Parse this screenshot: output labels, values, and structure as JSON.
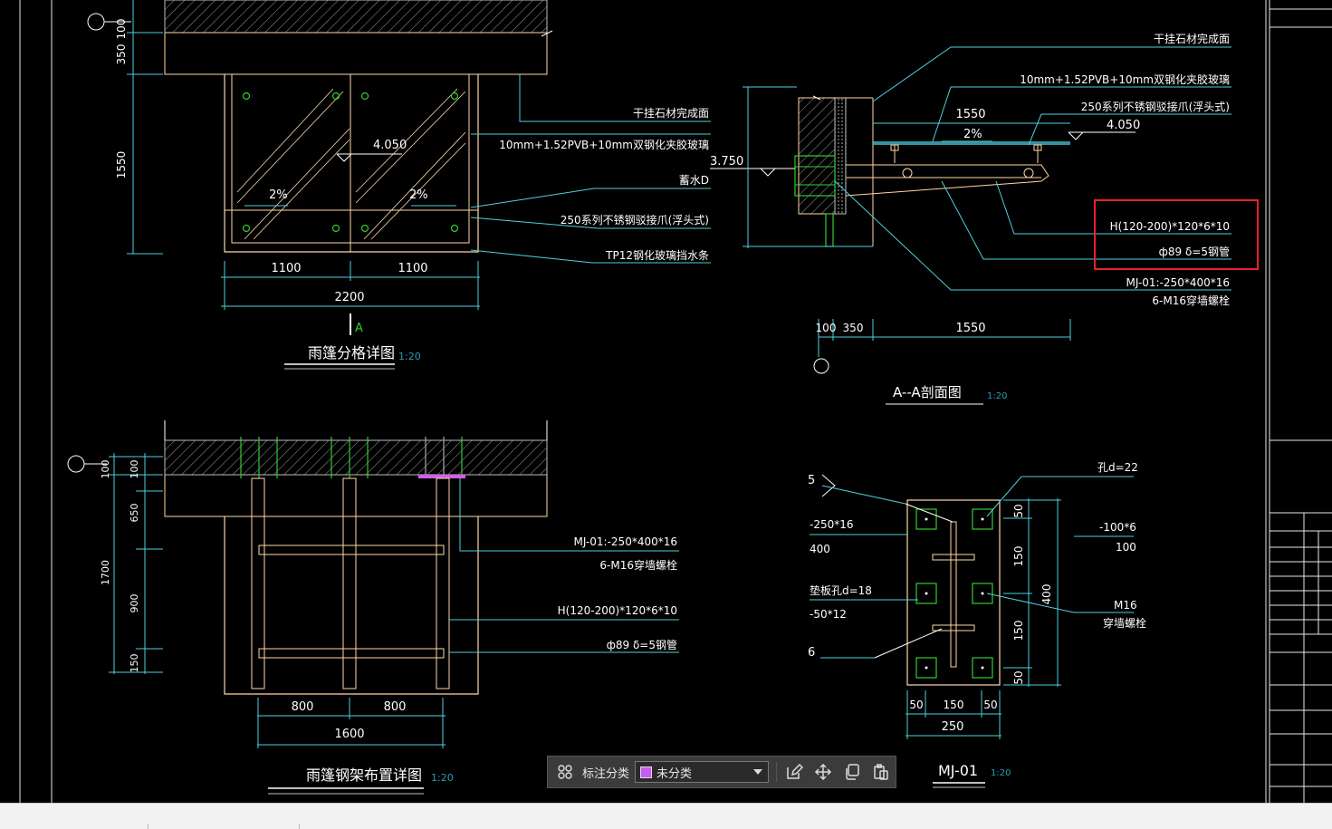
{
  "colors": {
    "background": "#000000",
    "white_text": "#ffffff",
    "hatch": "#b7b7b7",
    "outline": "#ffd7a6",
    "dim": "#4dd0e1",
    "leader": "#4dd0e1",
    "bolt_green": "#33cc33",
    "highlight_red": "#e8202a",
    "magenta": "#d65cf0",
    "scale_text": "#2f9bb3"
  },
  "drawing1": {
    "title": "雨篷分格详图",
    "scale": "1:20",
    "section_mark": "A",
    "level": "4.050",
    "slope_left": "2%",
    "slope_right": "2%",
    "left_dims": [
      "100",
      "350",
      "1550"
    ],
    "bottom_dims": [
      "1100",
      "1100"
    ],
    "total_dim": "2200",
    "notes": [
      "干挂石材完成面",
      "10mm+1.52PVB+10mm双钢化夹胶玻璃",
      "蓄水D",
      "250系列不锈钢驳接爪(浮头式)",
      "TP12钢化玻璃挡水条"
    ]
  },
  "drawing2": {
    "title": "A--A剖面图",
    "scale": "1:20",
    "level_top": "4.050",
    "level_left": "3.750",
    "slope": "2%",
    "top_dim": "1550",
    "bottom_dims": [
      "100",
      "350",
      "1550"
    ],
    "notes": [
      "干挂石材完成面",
      "10mm+1.52PVB+10mm双钢化夹胶玻璃",
      "250系列不锈钢驳接爪(浮头式)"
    ],
    "highlight_notes": [
      "H(120-200)*120*6*10",
      "ф89  δ=5钢管"
    ],
    "plate_notes": [
      "MJ-01:-250*400*16",
      "6-M16穿墙螺栓"
    ]
  },
  "drawing3": {
    "title": "雨篷钢架布置详图",
    "scale": "1:20",
    "left_dims": [
      "100",
      "100",
      "650",
      "1700",
      "900",
      "150"
    ],
    "bottom_dims": [
      "800",
      "800"
    ],
    "total_dim": "1600",
    "notes": [
      "MJ-01:-250*400*16",
      "6-M16穿墙螺栓",
      "H(120-200)*120*6*10",
      "ф89  δ=5钢管"
    ]
  },
  "drawing4": {
    "title": "MJ-01",
    "scale": "1:20",
    "weld_top": "5",
    "weld_bottom": "6",
    "left_notes": [
      "-250*16",
      "400",
      "垫板孔d=18",
      "-50*12"
    ],
    "right_notes": [
      "孔d=22",
      "-100*6",
      "100",
      "M16",
      "穿墙螺栓"
    ],
    "right_dims": [
      "50",
      "150",
      "150",
      "50"
    ],
    "right_total": "400",
    "bottom_dims": [
      "50",
      "150",
      "50"
    ],
    "total_dim": "250"
  },
  "toolbar": {
    "grid_icon": "grid-icon",
    "label": "标注分类",
    "select_value": "未分类",
    "select_color": "#c65cf0",
    "icons": [
      "edit-icon",
      "move-icon",
      "copy-icon",
      "paste-icon"
    ]
  }
}
